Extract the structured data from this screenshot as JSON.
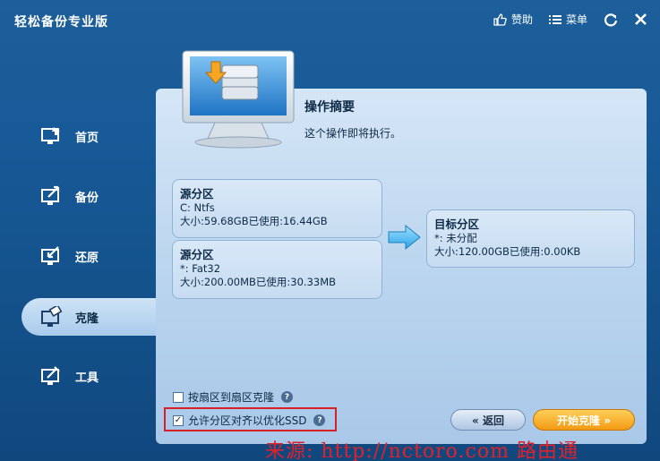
{
  "window": {
    "title": "轻松备份专业版",
    "like_label": "赞助",
    "menu_label": "菜单"
  },
  "sidebar": {
    "items": [
      {
        "label": "首页",
        "icon": "home-monitor-icon",
        "active": false
      },
      {
        "label": "备份",
        "icon": "backup-icon",
        "active": false
      },
      {
        "label": "还原",
        "icon": "restore-icon",
        "active": false
      },
      {
        "label": "克隆",
        "icon": "clone-icon",
        "active": true
      },
      {
        "label": "工具",
        "icon": "tools-icon",
        "active": false
      }
    ]
  },
  "summary": {
    "title": "操作摘要",
    "description": "这个操作即将执行。"
  },
  "source_partitions": [
    {
      "title": "源分区",
      "name": "C: Ntfs",
      "size": "大小:59.68GB已使用:16.44GB"
    },
    {
      "title": "源分区",
      "name": "*: Fat32",
      "size": "大小:200.00MB已使用:30.33MB"
    }
  ],
  "target_partition": {
    "title": "目标分区",
    "name": "*: 未分配",
    "size": "大小:120.00GB已使用:0.00KB"
  },
  "options": {
    "sector_clone": {
      "label": "按扇区到扇区克隆",
      "checked": false
    },
    "ssd_align": {
      "label": "允许分区对齐以优化SSD",
      "checked": true
    }
  },
  "buttons": {
    "back": "« 返回",
    "start": "开始克隆 »"
  },
  "watermark": "来源: http://nctoro.com 路由通",
  "colors": {
    "background": "#175a97",
    "panel": "#c7dcf1",
    "start_button": "#f39a12",
    "highlight_box": "#d81e27",
    "watermark": "#e0212b"
  }
}
